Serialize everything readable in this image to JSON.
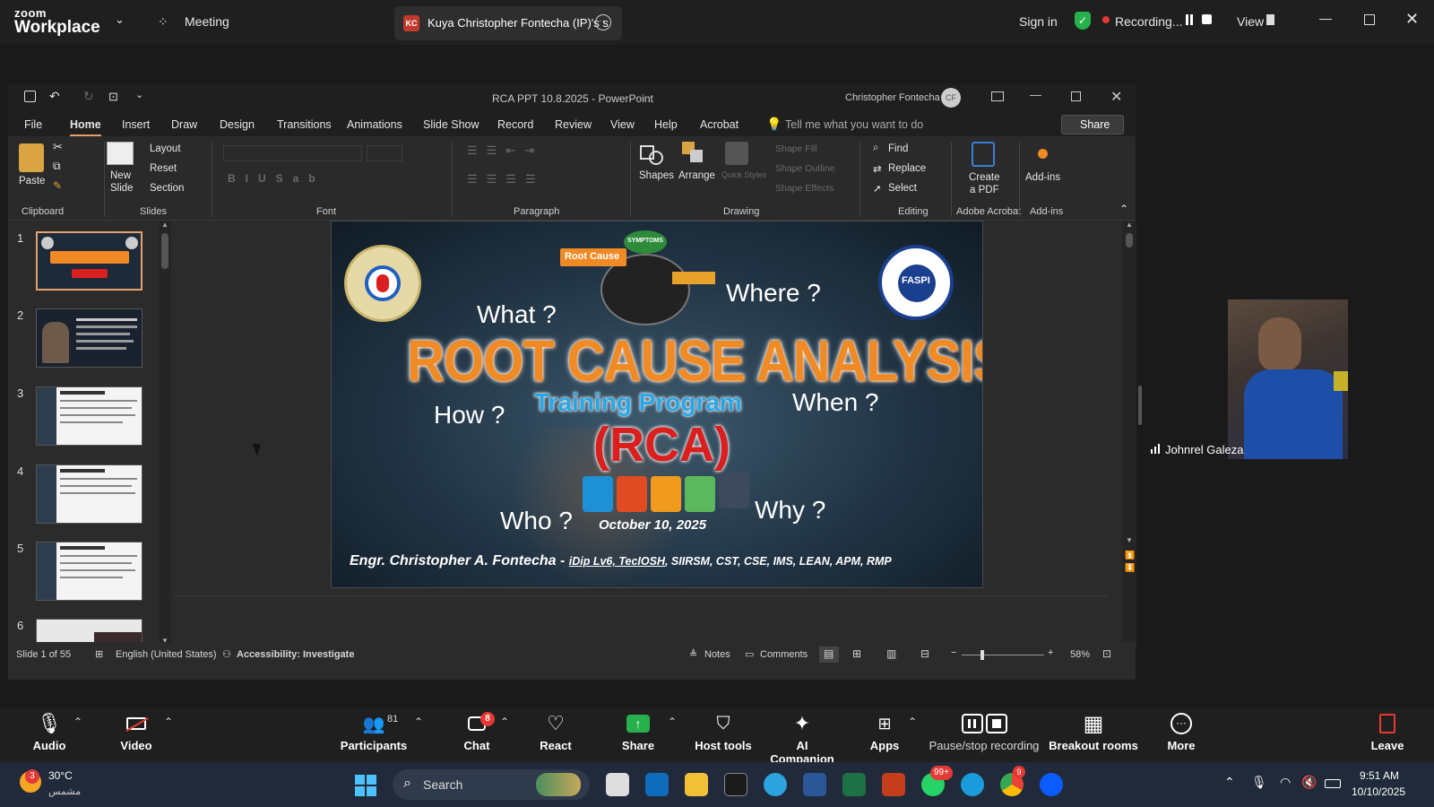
{
  "zoom": {
    "brand_line1": "zoom",
    "brand_line2": "Workplace",
    "meeting_label": "Meeting",
    "share_badge": "KC",
    "share_title": "Kuya Christopher Fontecha (IP)'s s",
    "sign_in": "Sign in",
    "recording_label": "Recording...",
    "view_label": "View"
  },
  "ppt": {
    "title": "RCA PPT 10.8.2025  -  PowerPoint",
    "user_name": "Christopher Fontecha",
    "user_initials": "CF",
    "tabs": [
      "File",
      "Home",
      "Insert",
      "Draw",
      "Design",
      "Transitions",
      "Animations",
      "Slide Show",
      "Record",
      "Review",
      "View",
      "Help",
      "Acrobat"
    ],
    "tell_me": "Tell me what you want to do",
    "share_btn": "Share",
    "ribbon": {
      "paste": "Paste",
      "new_slide_1": "New",
      "new_slide_2": "Slide",
      "layout": "Layout",
      "reset": "Reset",
      "section": "Section",
      "shapes": "Shapes",
      "arrange": "Arrange",
      "quick_styles": "Quick Styles",
      "shape_fill": "Shape Fill",
      "shape_outline": "Shape Outline",
      "shape_effects": "Shape Effects",
      "find": "Find",
      "replace": "Replace",
      "select": "Select",
      "create_pdf_1": "Create",
      "create_pdf_2": "a PDF",
      "addins": "Add-ins",
      "groups": {
        "clipboard": "Clipboard",
        "slides": "Slides",
        "font": "Font",
        "paragraph": "Paragraph",
        "drawing": "Drawing",
        "editing": "Editing",
        "acrobat": "Adobe Acrobat",
        "addins": "Add-ins"
      }
    },
    "thumb_numbers": [
      "1",
      "2",
      "3",
      "4",
      "5",
      "6"
    ],
    "status": {
      "slide_count": "Slide 1 of 55",
      "language": "English (United States)",
      "accessibility": "Accessibility: Investigate",
      "notes": "Notes",
      "comments": "Comments",
      "zoom": "58%"
    }
  },
  "slide": {
    "root_cause_tag": "Root Cause",
    "symptoms_tag": "SYMPTOMS",
    "q_what": "What ?",
    "q_where": "Where ?",
    "q_how": "How ?",
    "q_when": "When ?",
    "q_who": "Who ?",
    "q_why": "Why ?",
    "title": "ROOT CAUSE ANALYSIS",
    "subtitle": "Training Program",
    "acronym": "(RCA)",
    "date": "October 10, 2025",
    "presenter": "Engr. Christopher A. Fontecha - ",
    "credentials_underlined": "iDip Lv6, TecIOSH",
    "credentials_rest": ", SIIRSM, CST, CSE, IMS, LEAN, APM, RMP",
    "logo_right_text": "FASPI"
  },
  "participant": {
    "name": "Johnrel Galeza"
  },
  "toolbar": {
    "audio": "Audio",
    "video": "Video",
    "participants": "Participants",
    "participants_count": "81",
    "chat": "Chat",
    "chat_badge": "8",
    "react": "React",
    "share": "Share",
    "host_tools": "Host tools",
    "ai_companion": "AI Companion",
    "apps": "Apps",
    "pause_stop": "Pause/stop recording",
    "breakout": "Breakout rooms",
    "more": "More",
    "leave": "Leave"
  },
  "taskbar": {
    "weather_badge": "3",
    "temperature": "30°C",
    "weather_desc": "مشمس",
    "search": "Search",
    "whatsapp_badge": "99+",
    "chrome_badge": "9",
    "time": "9:51 AM",
    "date": "10/10/2025"
  },
  "colors": {
    "zoom_green": "#26b14c",
    "ppt_accent": "#e7a06b",
    "title_orange": "#f08a24",
    "rca_red": "#d9201f",
    "subtitle_blue": "#29a6e6"
  }
}
